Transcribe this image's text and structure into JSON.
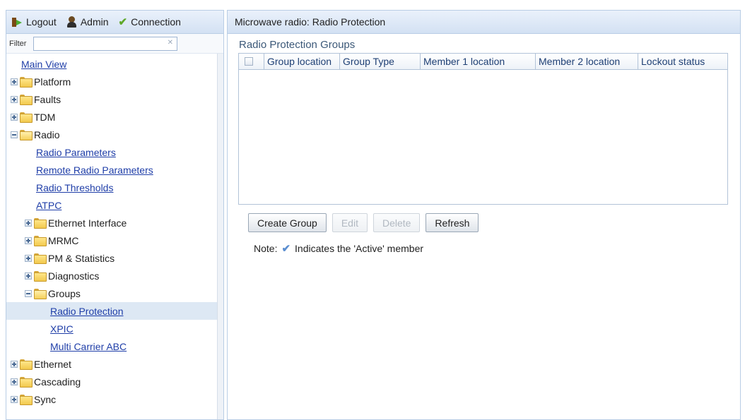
{
  "toolbar": {
    "logout_label": "Logout",
    "admin_label": "Admin",
    "connection_label": "Connection"
  },
  "filter": {
    "label": "Filter",
    "value": "",
    "placeholder": ""
  },
  "tree": {
    "main_view": "Main View",
    "platform": "Platform",
    "faults": "Faults",
    "tdm": "TDM",
    "radio": "Radio",
    "radio_parameters": "Radio Parameters",
    "remote_radio_parameters": "Remote Radio Parameters",
    "radio_thresholds": "Radio Thresholds",
    "atpc": "ATPC",
    "ethernet_interface": "Ethernet Interface",
    "mrmc": "MRMC",
    "pm_statistics": "PM & Statistics",
    "diagnostics": "Diagnostics",
    "groups": "Groups",
    "radio_protection": "Radio Protection",
    "xpic": "XPIC",
    "multi_carrier_abc": "Multi Carrier ABC",
    "ethernet": "Ethernet",
    "cascading": "Cascading",
    "sync": "Sync"
  },
  "main": {
    "header": "Microwave radio: Radio Protection",
    "section_title": "Radio Protection Groups",
    "columns": [
      "Group location",
      "Group Type",
      "Member 1 location",
      "Member 2 location",
      "Lockout status"
    ],
    "rows": [],
    "buttons": {
      "create_group": "Create Group",
      "edit": "Edit",
      "delete": "Delete",
      "refresh": "Refresh"
    },
    "note_prefix": "Note:",
    "note_text": "Indicates the 'Active' member"
  }
}
